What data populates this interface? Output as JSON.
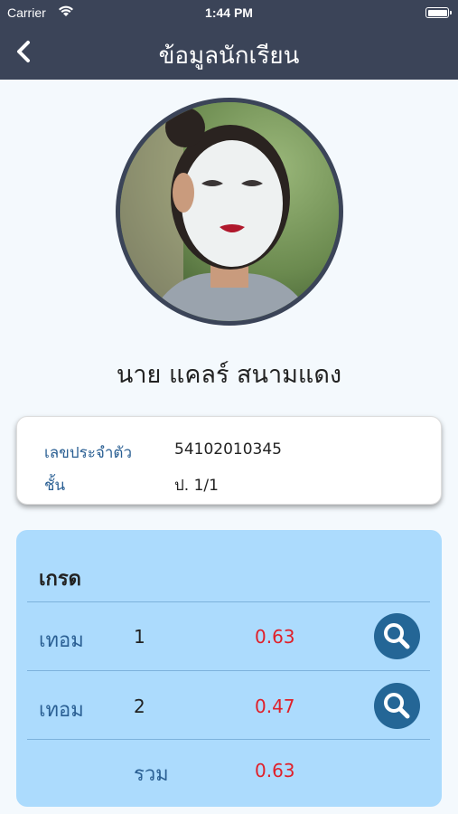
{
  "status_bar": {
    "carrier": "Carrier",
    "time": "1:44 PM"
  },
  "nav": {
    "title": "ข้อมูลนักเรียน",
    "back_icon": "chevron-left-icon"
  },
  "student": {
    "name": "นาย แคลร์ สนามแดง",
    "id_label": "เลขประจำตัว",
    "id_value": "54102010345",
    "class_label": "ชั้น",
    "class_value": "ป. 1/1"
  },
  "grades": {
    "title": "เกรด",
    "terms": [
      {
        "label": "เทอม",
        "number": "1",
        "gpa": "0.63",
        "action_icon": "search-icon"
      },
      {
        "label": "เทอม",
        "number": "2",
        "gpa": "0.47",
        "action_icon": "search-icon"
      }
    ],
    "total_label": "รวม",
    "total_gpa": "0.63"
  },
  "colors": {
    "header": "#3b4458",
    "grade_card": "#acdbfd",
    "accent_blue": "#246696",
    "gpa_red": "#e0202a"
  }
}
